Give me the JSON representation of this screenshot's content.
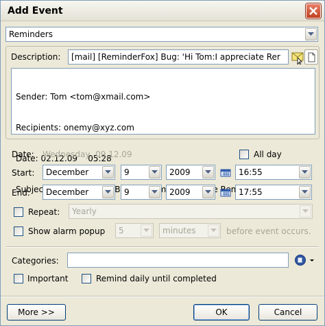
{
  "window": {
    "title": "Add Event"
  },
  "type_select": {
    "value": "Reminders"
  },
  "description": {
    "label": "Description:",
    "value": "[mail] [ReminderFox] Bug: 'Hi Tom:I appreciate Rer"
  },
  "notes": {
    "lines": [
      "Sender: Tom <tom@xmail.com>",
      "Recipients: onemy@xyz.com",
      "Date: 02.12.09    05:28",
      "Subject: [ReminderFox] Bug: 'Hi Tom:I appreciate ReminderFox...t...'"
    ]
  },
  "date": {
    "label": "Date:",
    "value": "Wednesday, 09.12.09",
    "all_day_label": "All day"
  },
  "start": {
    "label": "Start:",
    "month": "December",
    "day": "9",
    "year": "2009",
    "time": "16:55"
  },
  "end": {
    "label": "End:",
    "month": "December",
    "day": "9",
    "year": "2009",
    "time": "17:55"
  },
  "repeat": {
    "label": "Repeat:",
    "value": "Yearly"
  },
  "alarm": {
    "label": "Show alarm popup",
    "amount": "5",
    "unit": "minutes",
    "suffix": "before event occurs."
  },
  "categories": {
    "label": "Categories:",
    "value": ""
  },
  "important": {
    "label": "Important"
  },
  "remind_daily": {
    "label": "Remind daily until completed"
  },
  "buttons": {
    "more": "More >>",
    "ok": "OK",
    "cancel": "Cancel"
  },
  "colors": {
    "accent": "#003c74",
    "close_red": "#c1401f",
    "disabled_text": "#a7a699"
  }
}
